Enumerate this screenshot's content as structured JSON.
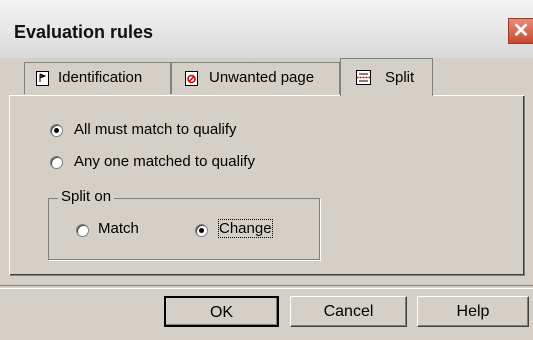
{
  "window": {
    "title": "Evaluation rules"
  },
  "tabs": [
    {
      "label": "Identification"
    },
    {
      "label": "Unwanted page"
    },
    {
      "label": "Split"
    }
  ],
  "qualify_options": [
    {
      "label": "All must match to qualify",
      "checked": true
    },
    {
      "label": "Any one matched to qualify",
      "checked": false
    }
  ],
  "split_group": {
    "title": "Split on",
    "options": [
      {
        "label": "Match",
        "checked": false
      },
      {
        "label": "Change",
        "checked": true
      }
    ]
  },
  "buttons": {
    "ok": "OK",
    "cancel": "Cancel",
    "help": "Help"
  },
  "icons": {
    "close": "close-icon",
    "identification": "document-flag-icon",
    "unwanted": "document-ban-icon",
    "split": "split-page-icon"
  },
  "colors": {
    "face": "#d4d0c8",
    "close_button": "#c84a2e"
  }
}
